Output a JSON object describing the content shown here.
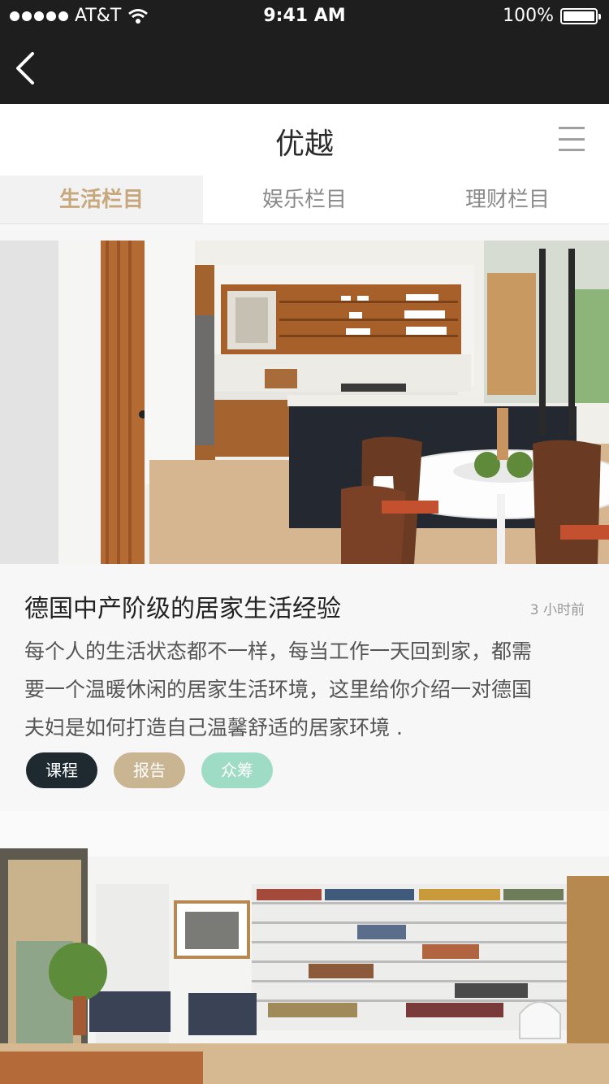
{
  "status": {
    "carrier": "AT&T",
    "time": "9:41 AM",
    "battery": "100%"
  },
  "header": {
    "title": "优越"
  },
  "tabs": [
    "生活栏目",
    "娱乐栏目",
    "理财栏目"
  ],
  "article": {
    "title": "德国中产阶级的居家生活经验",
    "time": "3 小时前",
    "description_lines": [
      "每个人的生活状态都不一样，每当工作一天回到家，都需",
      "要一个温暖休闲的居家生活环境，这里给你介绍一对德国",
      "夫妇是如何打造自己温馨舒适的居家环境 ."
    ],
    "tags": [
      "课程",
      "报告",
      "众筹"
    ]
  },
  "colors": {
    "accent": "#c7a77b",
    "dark": "#1e1e1e",
    "tag_dark": "#1f2a30",
    "tag_beige": "#c9b592",
    "tag_mint": "#9fdcc5"
  },
  "icons": [
    "back-icon",
    "menu-icon",
    "wifi-icon",
    "battery-icon",
    "signal-icon"
  ]
}
